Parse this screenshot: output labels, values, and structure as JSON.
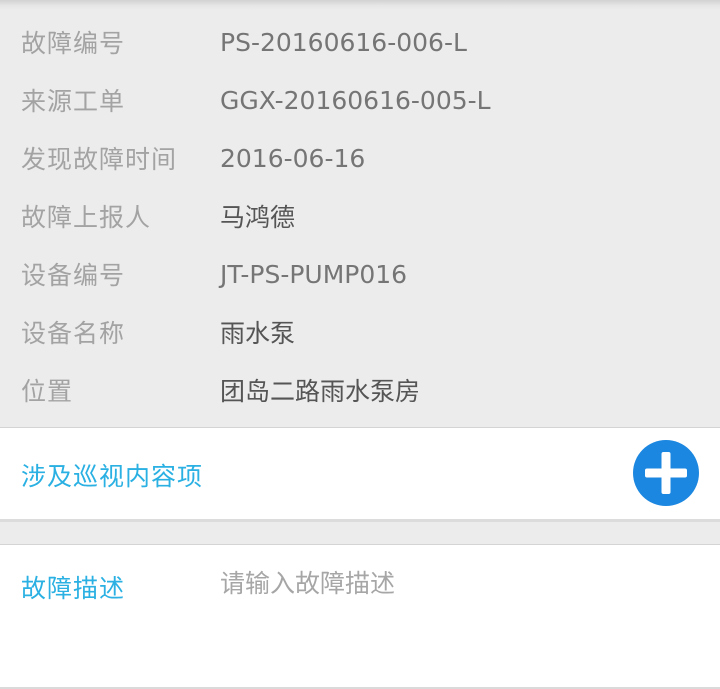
{
  "fault_info": {
    "rows": [
      {
        "label": "故障编号",
        "value": "PS-20160616-006-L"
      },
      {
        "label": "来源工单",
        "value": "GGX-20160616-005-L"
      },
      {
        "label": "发现故障时间",
        "value": "2016-06-16"
      },
      {
        "label": "故障上报人",
        "value": "马鸿德"
      },
      {
        "label": "设备编号",
        "value": "JT-PS-PUMP016"
      },
      {
        "label": "设备名称",
        "value": "雨水泵"
      },
      {
        "label": "位置",
        "value": "团岛二路雨水泵房"
      }
    ]
  },
  "patrol_items": {
    "label": "涉及巡视内容项",
    "add_icon": "plus-circle-icon"
  },
  "fault_description": {
    "label": "故障描述",
    "placeholder": "请输入故障描述",
    "value": ""
  },
  "colors": {
    "accent_text": "#2ab0e2",
    "add_button": "#1c87e0",
    "info_background": "#ececec",
    "label_text": "#a3a3a3",
    "value_text": "#757575"
  }
}
